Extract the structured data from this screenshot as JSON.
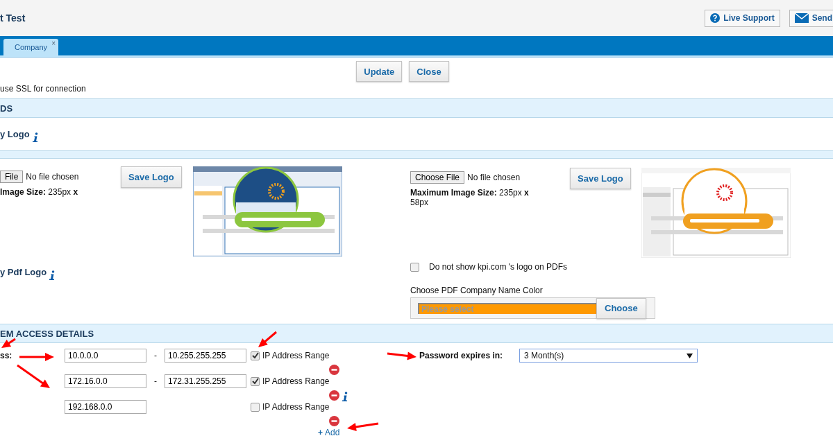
{
  "header": {
    "title": "t Test",
    "buttons": [
      {
        "kind": "help",
        "label": "Live Support"
      },
      {
        "kind": "mail",
        "label": "Send"
      }
    ]
  },
  "tabs": [
    {
      "label": "Company",
      "close": "×",
      "selected": true
    }
  ],
  "actions": [
    "Update",
    "Close"
  ],
  "ssl_note": "use SSL for connection",
  "logos": {
    "title": "DS",
    "company_logo_label": "y Logo",
    "uploads": [
      {
        "file_button": "File",
        "file_status": "No file chosen",
        "size": "**Image Size:** 235px **x**",
        "save": "Save Logo"
      },
      {
        "file_button": "Choose File",
        "file_status": "No file chosen",
        "size": "**Maximum Image Size:** 235px **x** 58px",
        "save": "Save Logo"
      }
    ],
    "pdf_logo_label": "y Pdf Logo",
    "hide_logo": {
      "label": "Do not show kpi.com 's logo on PDFs",
      "checked": false
    },
    "color": {
      "label": "Choose PDF Company Name Color",
      "placeholder": "Please select",
      "button": "Choose"
    }
  },
  "access": {
    "title": "EM ACCESS DETAILS",
    "ip_label": "ss:",
    "ranges": [
      {
        "from": "10.0.0.0",
        "separator": "-",
        "to": "10.255.255.255",
        "range_label": "IP Address Range",
        "checked": true,
        "info": false
      },
      {
        "from": "172.16.0.0",
        "separator": "-",
        "to": "172.31.255.255",
        "range_label": "IP Address Range",
        "checked": true,
        "info": true
      },
      {
        "from": "192.168.0.0",
        "range_label": "IP Address Range",
        "checked": false,
        "info": false
      }
    ],
    "add": {
      "plus": "+",
      "label": "Add"
    },
    "password": {
      "label": "Password expires in:",
      "value": "3 Month(s)"
    }
  }
}
